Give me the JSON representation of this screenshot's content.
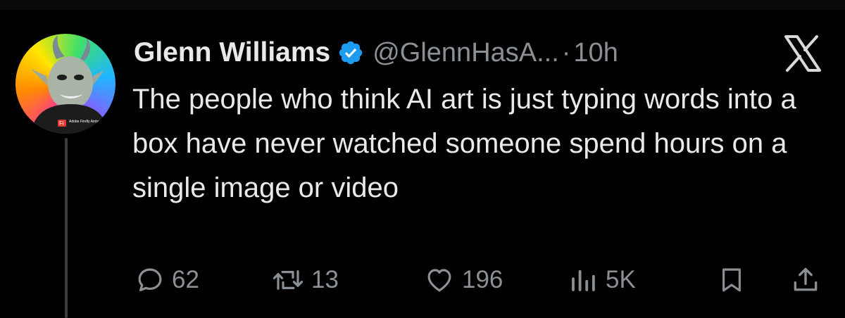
{
  "tweet": {
    "author": {
      "display_name": "Glenn Williams",
      "handle": "@GlennHasA...",
      "verified": true,
      "avatar_badge": "Adobe Firefly Ambassador",
      "avatar_badge_logo": "Fi"
    },
    "separator": "·",
    "timestamp": "10h",
    "text": "The people who think AI art is just typing words into a box have never watched someone spend hours on a single image or video",
    "platform_logo": "x-logo-icon"
  },
  "actions": {
    "reply": {
      "icon": "reply-icon",
      "count": "62"
    },
    "retweet": {
      "icon": "retweet-icon",
      "count": "13"
    },
    "like": {
      "icon": "heart-icon",
      "count": "196"
    },
    "views": {
      "icon": "views-icon",
      "count": "5K"
    },
    "bookmark": {
      "icon": "bookmark-icon"
    },
    "share": {
      "icon": "share-icon"
    }
  },
  "colors": {
    "background": "#000000",
    "text_primary": "#e7e9ea",
    "text_secondary": "#8b9095",
    "verified_blue": "#1d9bf0",
    "thread_line": "#3a3d40"
  }
}
